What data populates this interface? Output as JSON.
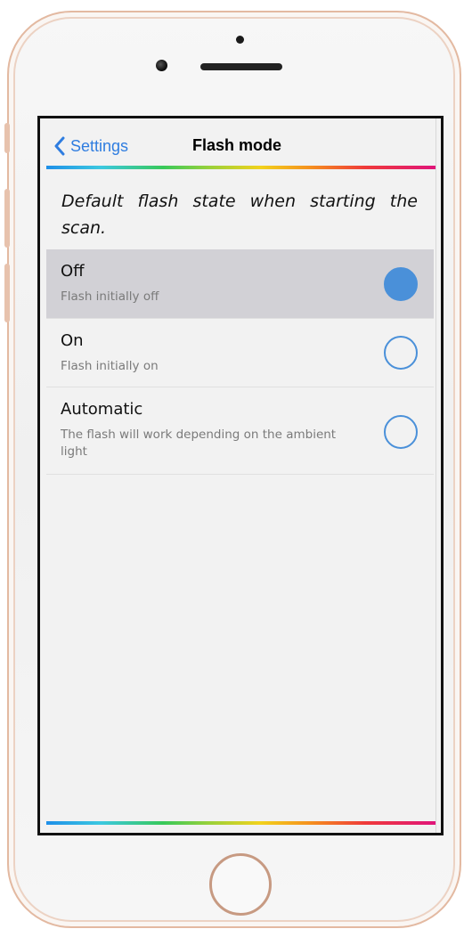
{
  "header": {
    "back_label": "Settings",
    "title": "Flash mode"
  },
  "description": "Default flash state when starting the scan.",
  "options": [
    {
      "title": "Off",
      "description": "Flash initially off",
      "selected": true
    },
    {
      "title": "On",
      "description": "Flash initially on",
      "selected": false
    },
    {
      "title": "Automatic",
      "description": "The flash will work depending on the ambient light",
      "selected": false
    }
  ],
  "icons": {
    "back": "chevron-left-icon",
    "radio": "radio-button-icon"
  },
  "colors": {
    "accent": "#2f7de0",
    "radio": "#4a90d9",
    "selected_row": "#d2d1d6",
    "phone_frame": "#e3b9a1"
  }
}
